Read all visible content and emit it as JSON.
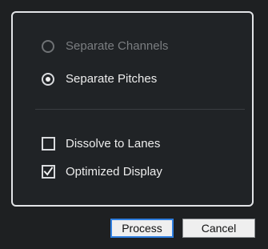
{
  "options": {
    "separate_channels": {
      "label": "Separate Channels",
      "enabled": false,
      "selected": false
    },
    "separate_pitches": {
      "label": "Separate Pitches",
      "enabled": true,
      "selected": true
    },
    "dissolve_to_lanes": {
      "label": "Dissolve to Lanes",
      "checked": false
    },
    "optimized_display": {
      "label": "Optimized Display",
      "checked": true
    }
  },
  "buttons": {
    "process_label": "Process",
    "cancel_label": "Cancel"
  },
  "colors": {
    "background": "#1e2022",
    "panel_border": "#e2e4e7",
    "text": "#ededed",
    "disabled_text": "#7b7e81",
    "default_button_border": "#2f7fe0"
  }
}
